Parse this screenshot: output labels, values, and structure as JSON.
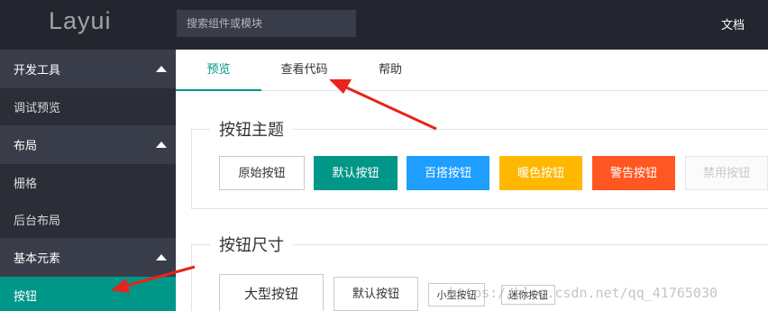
{
  "header": {
    "logo": "Layui",
    "search_placeholder": "搜索组件或模块",
    "doc_label": "文档"
  },
  "sidebar": {
    "groups": [
      {
        "label": "开发工具",
        "items": [
          "调试预览"
        ]
      },
      {
        "label": "布局",
        "items": [
          "栅格",
          "后台布局"
        ]
      },
      {
        "label": "基本元素",
        "items": [
          "按钮"
        ]
      }
    ]
  },
  "tabs": [
    "预览",
    "查看代码",
    "帮助"
  ],
  "sections": {
    "theme": {
      "title": "按钮主题",
      "buttons": [
        "原始按钮",
        "默认按钮",
        "百搭按钮",
        "暖色按钮",
        "警告按钮",
        "禁用按钮"
      ]
    },
    "size": {
      "title": "按钮尺寸",
      "buttons": [
        "大型按钮",
        "默认按钮",
        "小型按钮",
        "迷你按钮"
      ]
    }
  },
  "watermark": "https://blog.csdn.net/qq_41765030",
  "colors": {
    "header_bg": "#23262e",
    "sidebar_bg": "#2b2e37",
    "accent": "#009688",
    "blue": "#1e9fff",
    "warm": "#ffb800",
    "danger": "#ff5722",
    "arrow": "#e8231b"
  }
}
